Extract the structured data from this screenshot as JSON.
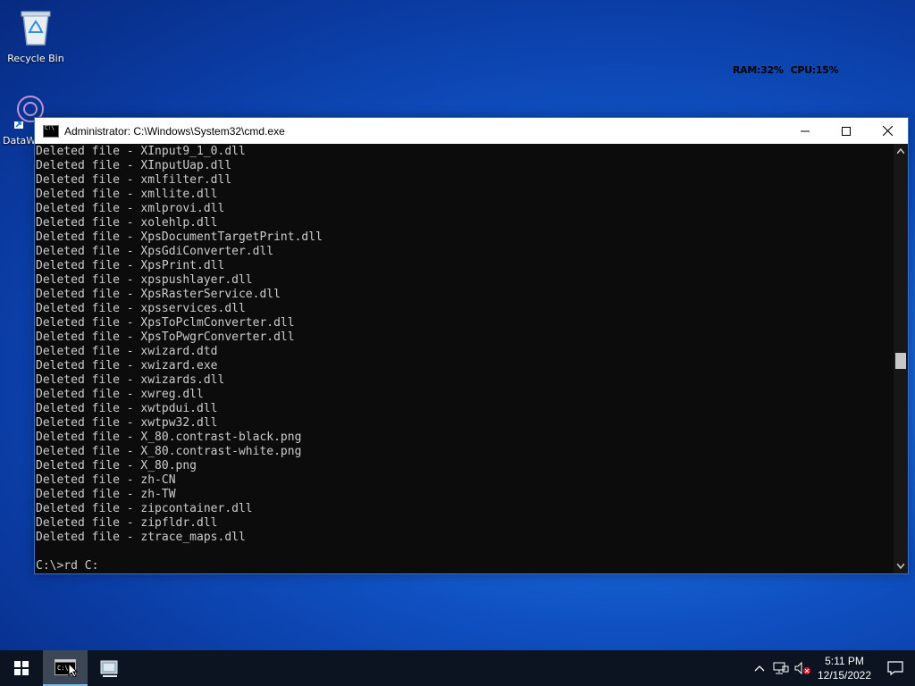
{
  "desktop": {
    "icons": [
      {
        "label": "Recycle Bin"
      },
      {
        "label": "DataW"
      }
    ],
    "sysinfo": {
      "ram": "RAM:32%",
      "cpu": "CPU:15%"
    }
  },
  "window": {
    "title": "Administrator:  C:\\Windows\\System32\\cmd.exe",
    "lines": [
      "Deleted file - XInput9_1_0.dll",
      "Deleted file - XInputUap.dll",
      "Deleted file - xmlfilter.dll",
      "Deleted file - xmllite.dll",
      "Deleted file - xmlprovi.dll",
      "Deleted file - xolehlp.dll",
      "Deleted file - XpsDocumentTargetPrint.dll",
      "Deleted file - XpsGdiConverter.dll",
      "Deleted file - XpsPrint.dll",
      "Deleted file - xpspushlayer.dll",
      "Deleted file - XpsRasterService.dll",
      "Deleted file - xpsservices.dll",
      "Deleted file - XpsToPclmConverter.dll",
      "Deleted file - XpsToPwgrConverter.dll",
      "Deleted file - xwizard.dtd",
      "Deleted file - xwizard.exe",
      "Deleted file - xwizards.dll",
      "Deleted file - xwreg.dll",
      "Deleted file - xwtpdui.dll",
      "Deleted file - xwtpw32.dll",
      "Deleted file - X_80.contrast-black.png",
      "Deleted file - X_80.contrast-white.png",
      "Deleted file - X_80.png",
      "Deleted file - zh-CN",
      "Deleted file - zh-TW",
      "Deleted file - zipcontainer.dll",
      "Deleted file - zipfldr.dll",
      "Deleted file - ztrace_maps.dll",
      "",
      "C:\\>rd C:"
    ]
  },
  "taskbar": {
    "clock": {
      "time": "5:11 PM",
      "date": "12/15/2022"
    }
  },
  "colors": {
    "console_bg": "#0c0c0c",
    "console_text": "#cccccc",
    "taskbar_bg": "#0b1420",
    "desktop_blue": "#0f4fc0"
  }
}
